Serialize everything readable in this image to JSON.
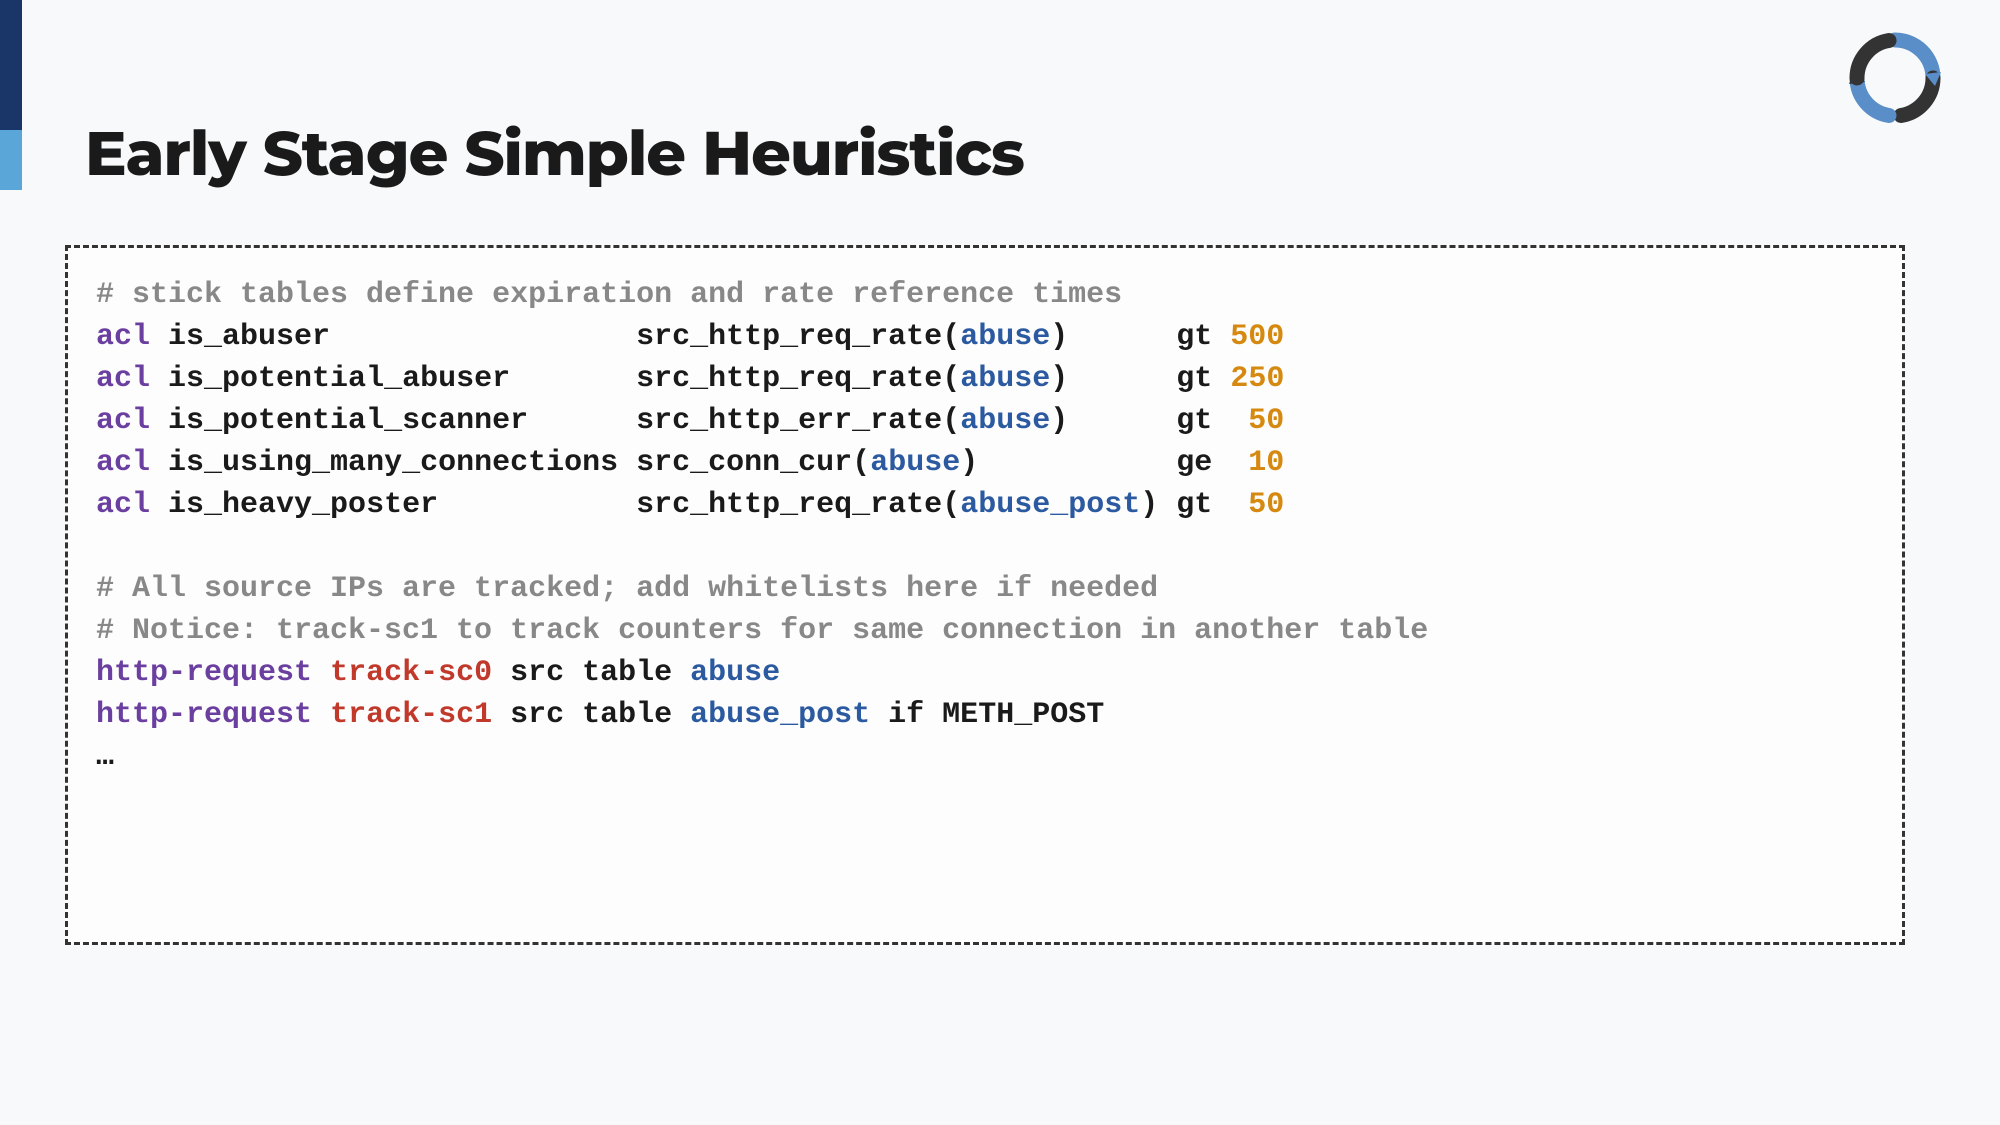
{
  "title": "Early Stage Simple Heuristics",
  "code": {
    "comment1": "# stick tables define expiration and rate reference times",
    "acl_lines": [
      {
        "kw": "acl",
        "name": "is_abuser",
        "name_pad": "                ",
        "func": "src_http_req_rate",
        "arg": "abuse",
        "post_func_pad": "      ",
        "op": "gt",
        "val": "500",
        "val_pad": " "
      },
      {
        "kw": "acl",
        "name": "is_potential_abuser",
        "name_pad": "      ",
        "func": "src_http_req_rate",
        "arg": "abuse",
        "post_func_pad": "      ",
        "op": "gt",
        "val": "250",
        "val_pad": " "
      },
      {
        "kw": "acl",
        "name": "is_potential_scanner",
        "name_pad": "     ",
        "func": "src_http_err_rate",
        "arg": "abuse",
        "post_func_pad": "      ",
        "op": "gt",
        "val": "50",
        "val_pad": "  "
      },
      {
        "kw": "acl",
        "name": "is_using_many_connections",
        "name_pad": "",
        "func": "src_conn_cur",
        "arg": "abuse",
        "post_func_pad": "           ",
        "op": "ge",
        "val": "10",
        "val_pad": "  "
      },
      {
        "kw": "acl",
        "name": "is_heavy_poster",
        "name_pad": "          ",
        "func": "src_http_req_rate",
        "arg": "abuse_post",
        "post_func_pad": " ",
        "op": "gt",
        "val": "50",
        "val_pad": "  "
      }
    ],
    "comment2": "# All source IPs are tracked; add whitelists here if needed",
    "comment3": "# Notice: track-sc1 to track counters for same connection in another table",
    "track_lines": [
      {
        "cmd": "http-request",
        "track": "track-sc0",
        "rest_pre": " src table ",
        "table": "abuse",
        "rest_post": ""
      },
      {
        "cmd": "http-request",
        "track": "track-sc1",
        "rest_pre": " src table ",
        "table": "abuse_post",
        "rest_post": " if METH_POST"
      }
    ],
    "ellipsis": "…"
  }
}
